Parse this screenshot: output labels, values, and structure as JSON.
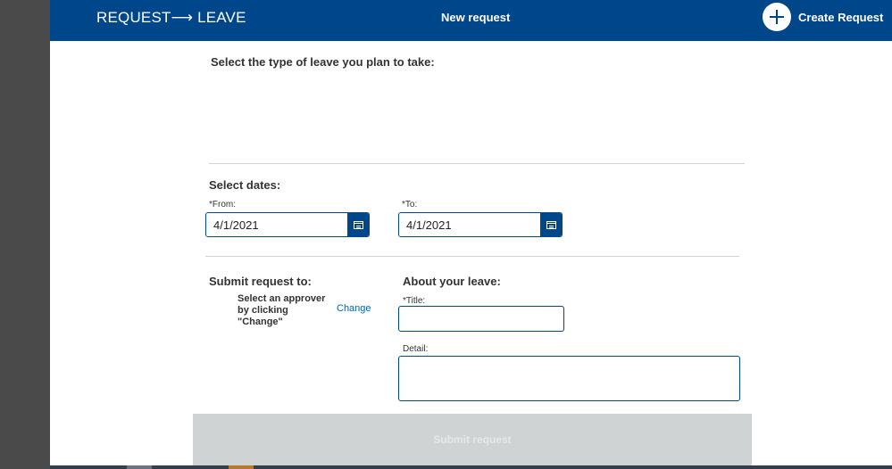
{
  "header": {
    "app_title": "REQUEST⟶ LEAVE",
    "center_title": "New request",
    "create_label": "Create Request"
  },
  "leave_type": {
    "prompt": "Select the type of leave you plan to take:"
  },
  "dates": {
    "heading": "Select dates:",
    "from_label": "*From:",
    "from_value": "4/1/2021",
    "to_label": "*To:",
    "to_value": "4/1/2021"
  },
  "submit_to": {
    "heading": "Submit request to:",
    "approver_text": "Select an approver by clicking \"Change\"",
    "change_link": "Change"
  },
  "about": {
    "heading": "About your leave:",
    "title_label": "*Title:",
    "title_value": "",
    "detail_label": "Detail:",
    "detail_value": ""
  },
  "submit_button": "Submit request",
  "colors": {
    "brand": "#00468b",
    "link": "#0063b1",
    "disabled_bar": "#d0d3d3"
  }
}
